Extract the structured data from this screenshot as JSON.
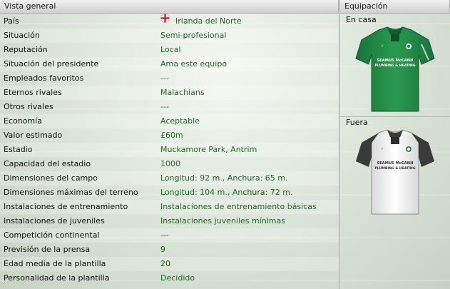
{
  "overview": {
    "title": "Vista general",
    "rows": [
      {
        "label": "País",
        "value": "Irlanda del Norte"
      },
      {
        "label": "Situación",
        "value": "Semi-profesional"
      },
      {
        "label": "Reputación",
        "value": "Local"
      },
      {
        "label": "Situación del presidente",
        "value": "Ama este equipo"
      },
      {
        "label": "Empleados favoritos",
        "value": "---"
      },
      {
        "label": "Eternos rivales",
        "value": "Malachians"
      },
      {
        "label": "Otros rivales",
        "value": "---"
      },
      {
        "label": "Economía",
        "value": "Aceptable"
      },
      {
        "label": "Valor estimado",
        "value": "£60m"
      },
      {
        "label": "Estadio",
        "value": "Muckamore Park, Antrim"
      },
      {
        "label": "Capacidad del estadio",
        "value": "1000"
      },
      {
        "label": "Dimensiones del campo",
        "value": "Longitud: 92 m., Anchura: 65 m."
      },
      {
        "label": "Dimensiones máximas del terreno",
        "value": "Longitud: 104 m., Anchura: 72 m."
      },
      {
        "label": "Instalaciones de entrenamiento",
        "value": "Instalaciones de entrenamiento básicas"
      },
      {
        "label": "Instalaciones de juveniles",
        "value": "Instalaciones juveniles mínimas"
      },
      {
        "label": "Competición continental",
        "value": "---"
      },
      {
        "label": "Previsión de la prensa",
        "value": "9"
      },
      {
        "label": "Edad media de la plantilla",
        "value": "20"
      },
      {
        "label": "Personalidad de la plantilla",
        "value": "Decidido"
      }
    ]
  },
  "kits": {
    "title": "Equipación",
    "home_label": "En casa",
    "away_label": "Fuera",
    "sponsor_line1": "SEAMUS McCANN",
    "sponsor_line2": "PLUMBING & HEATING",
    "home_color": "#1f8a3f",
    "away_color": "#f2f2f2",
    "away_sleeve_color": "#3a3a3a"
  },
  "colors": {
    "value_text": "#1b6a22",
    "flag_red": "#cc1f2a"
  }
}
